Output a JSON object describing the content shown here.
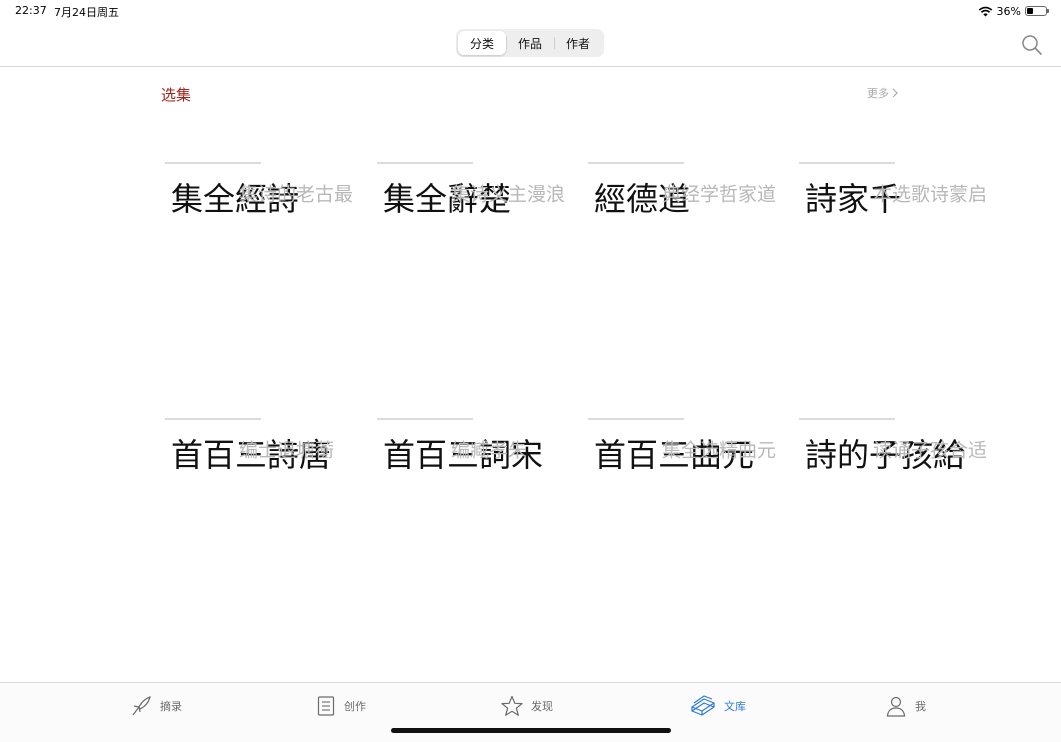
{
  "status_bar": {
    "time": "22:37",
    "date": "7月24日周五",
    "battery_text": "36%",
    "battery_level": 0.36
  },
  "nav": {
    "segments": [
      "分类",
      "作品",
      "作者"
    ],
    "active_segment": 0
  },
  "section": {
    "title": "选集",
    "more": "更多"
  },
  "cards": [
    {
      "title": "詩經全集",
      "subtitle": "最古老的诗集"
    },
    {
      "title": "楚辭全集",
      "subtitle": "浪漫主义诗集"
    },
    {
      "title": "道德經",
      "subtitle": "道家哲学经典"
    },
    {
      "title": "千家詩",
      "subtitle": "启蒙诗歌选本"
    },
    {
      "title": "唐詩三百首",
      "subtitle": "蘅塘退士编"
    },
    {
      "title": "宋詞三百首",
      "subtitle": "朱孝臧编"
    },
    {
      "title": "元曲三百首",
      "subtitle": "元曲精选全集"
    },
    {
      "title": "給孩子的詩",
      "subtitle": "适合孩子诵读"
    }
  ],
  "tabs": [
    {
      "label": "摘录",
      "icon": "quill-pen-icon"
    },
    {
      "label": "创作",
      "icon": "notebook-icon"
    },
    {
      "label": "发现",
      "icon": "star-icon"
    },
    {
      "label": "文库",
      "icon": "books-icon"
    },
    {
      "label": "我",
      "icon": "person-icon"
    }
  ],
  "active_tab": 3,
  "colors": {
    "accent_red": "#a3241c",
    "tab_active_blue": "#2f7bd6",
    "subtitle_gray": "#b8b8b8"
  }
}
